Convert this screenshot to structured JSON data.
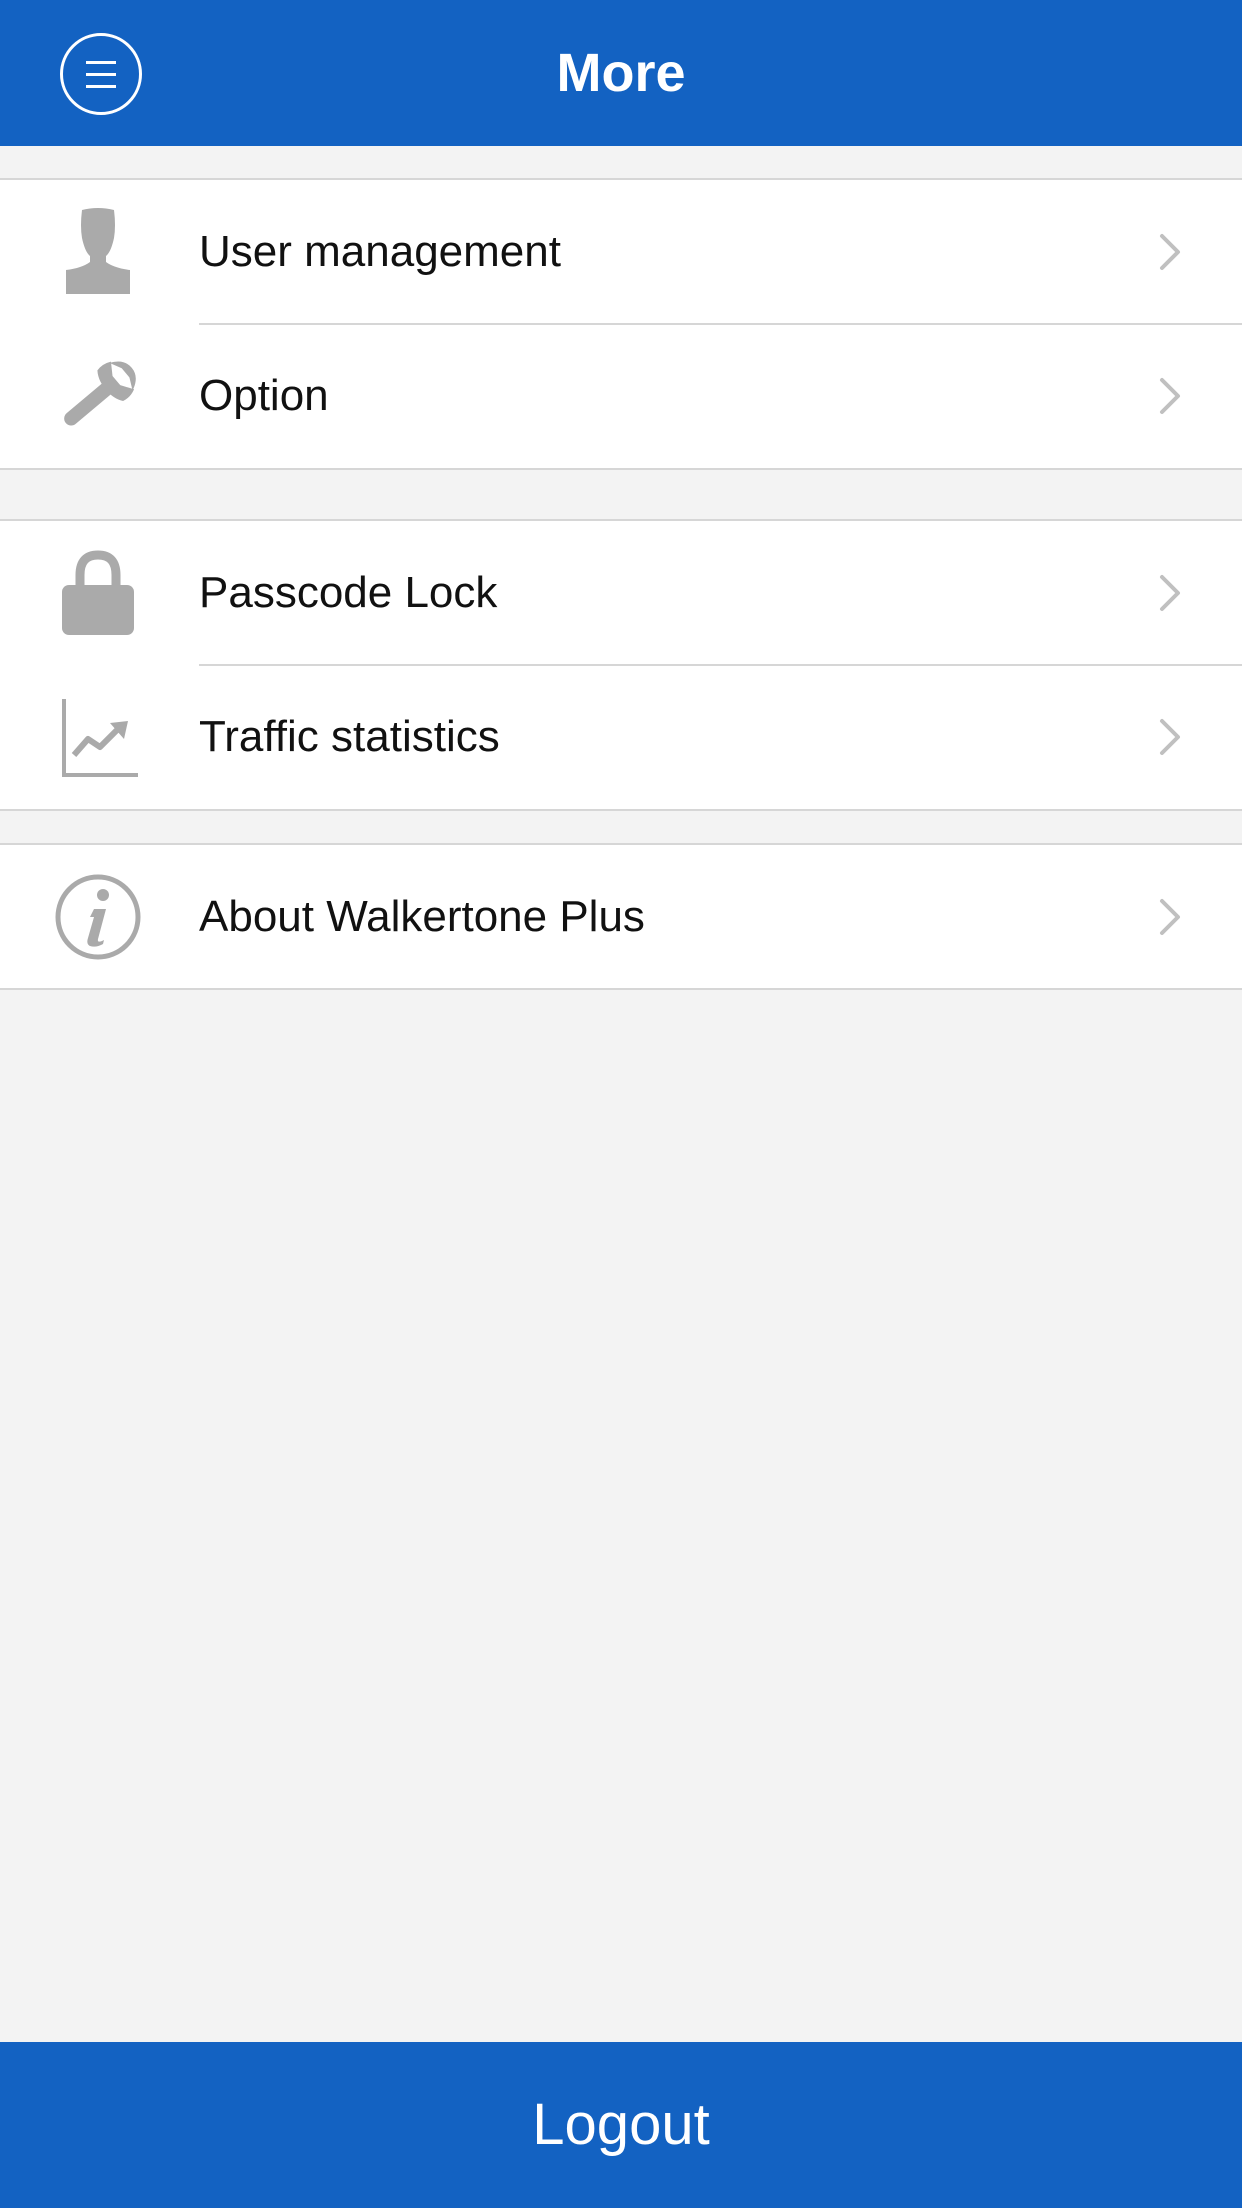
{
  "header": {
    "title": "More",
    "menu_icon": "menu-circle-icon",
    "color": "#1362c2"
  },
  "groups": [
    {
      "items": [
        {
          "label": "User management",
          "icon": "user-icon"
        },
        {
          "label": "Option",
          "icon": "wrench-icon"
        }
      ]
    },
    {
      "items": [
        {
          "label": "Passcode Lock",
          "icon": "lock-icon"
        },
        {
          "label": "Traffic statistics",
          "icon": "chart-icon"
        }
      ]
    },
    {
      "items": [
        {
          "label": "About Walkertone Plus",
          "icon": "info-icon"
        }
      ]
    }
  ],
  "footer": {
    "logout_label": "Logout"
  },
  "colors": {
    "accent": "#1362c2",
    "background": "#f3f3f3",
    "icon": "#aaaaaa",
    "chevron": "#c0c0c0"
  }
}
